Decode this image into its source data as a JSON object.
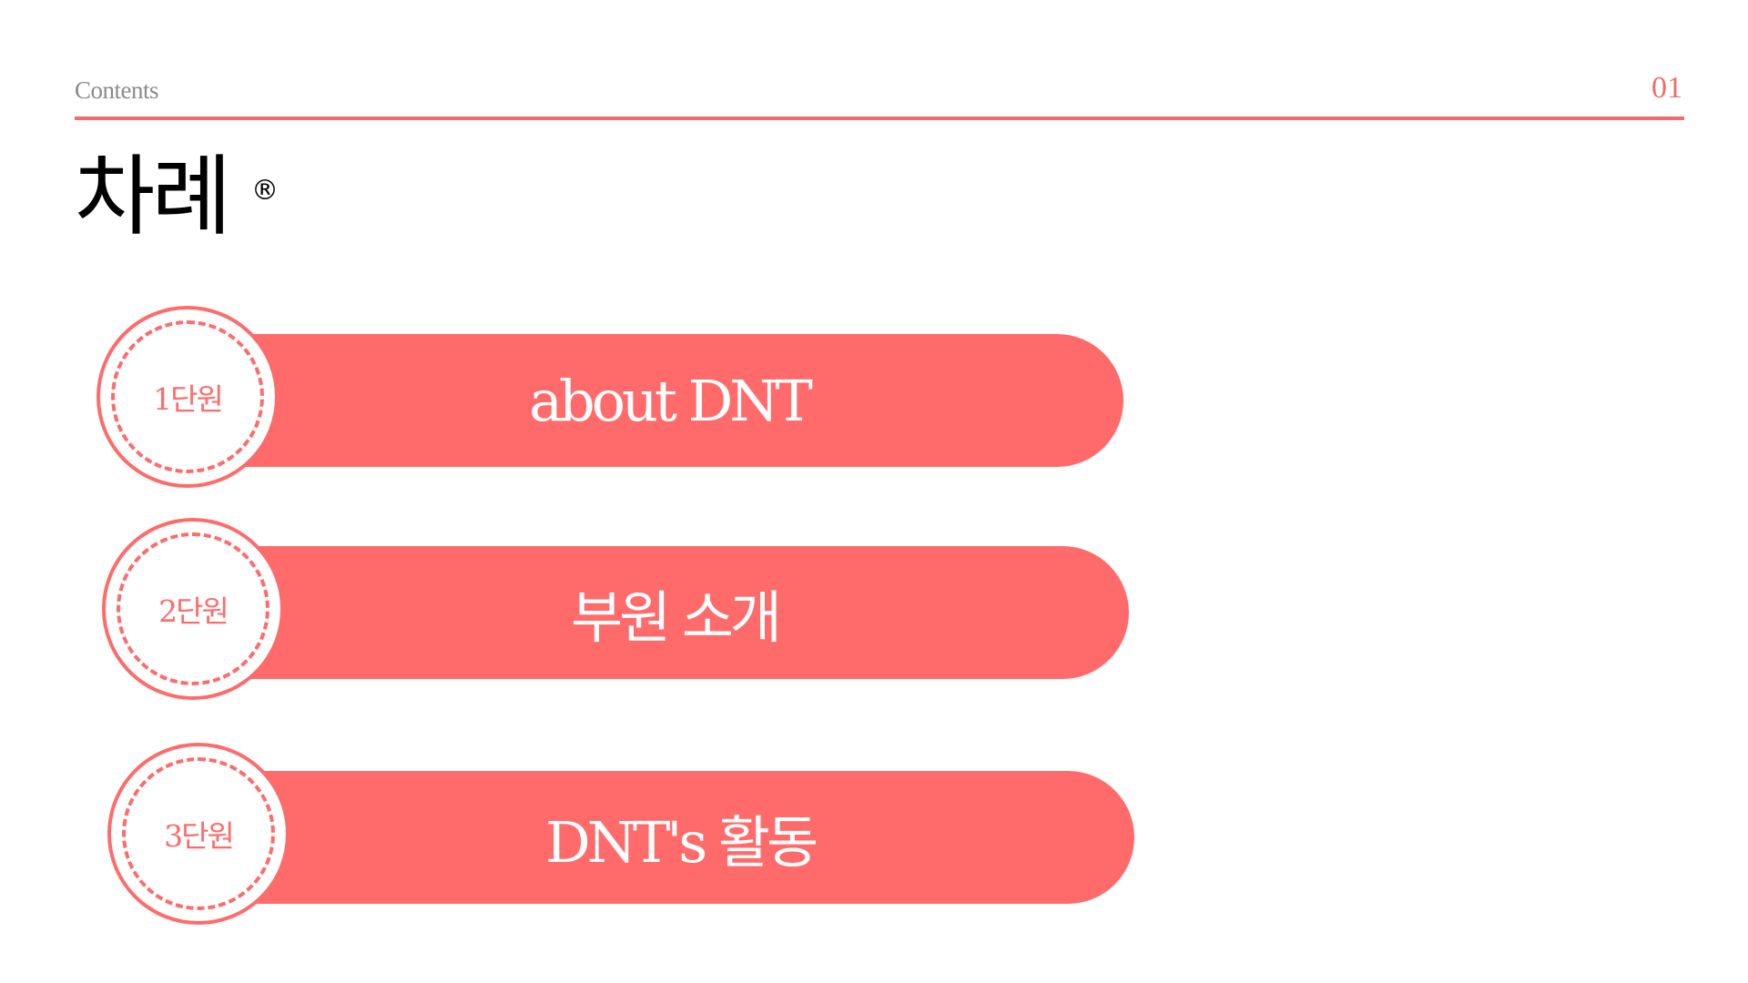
{
  "header": {
    "label": "Contents",
    "page_number": "01"
  },
  "title": {
    "text": "차례",
    "mark": "®"
  },
  "units": [
    {
      "number_label": "1단원",
      "title": "about DNT"
    },
    {
      "number_label": "2단원",
      "title": "부원 소개"
    },
    {
      "number_label": "3단원",
      "title": "DNT's 활동"
    }
  ],
  "colors": {
    "accent": "#ff6b6b",
    "rule": "#f26b6b",
    "header_text": "#8a8a8a",
    "title_text": "#000000"
  }
}
